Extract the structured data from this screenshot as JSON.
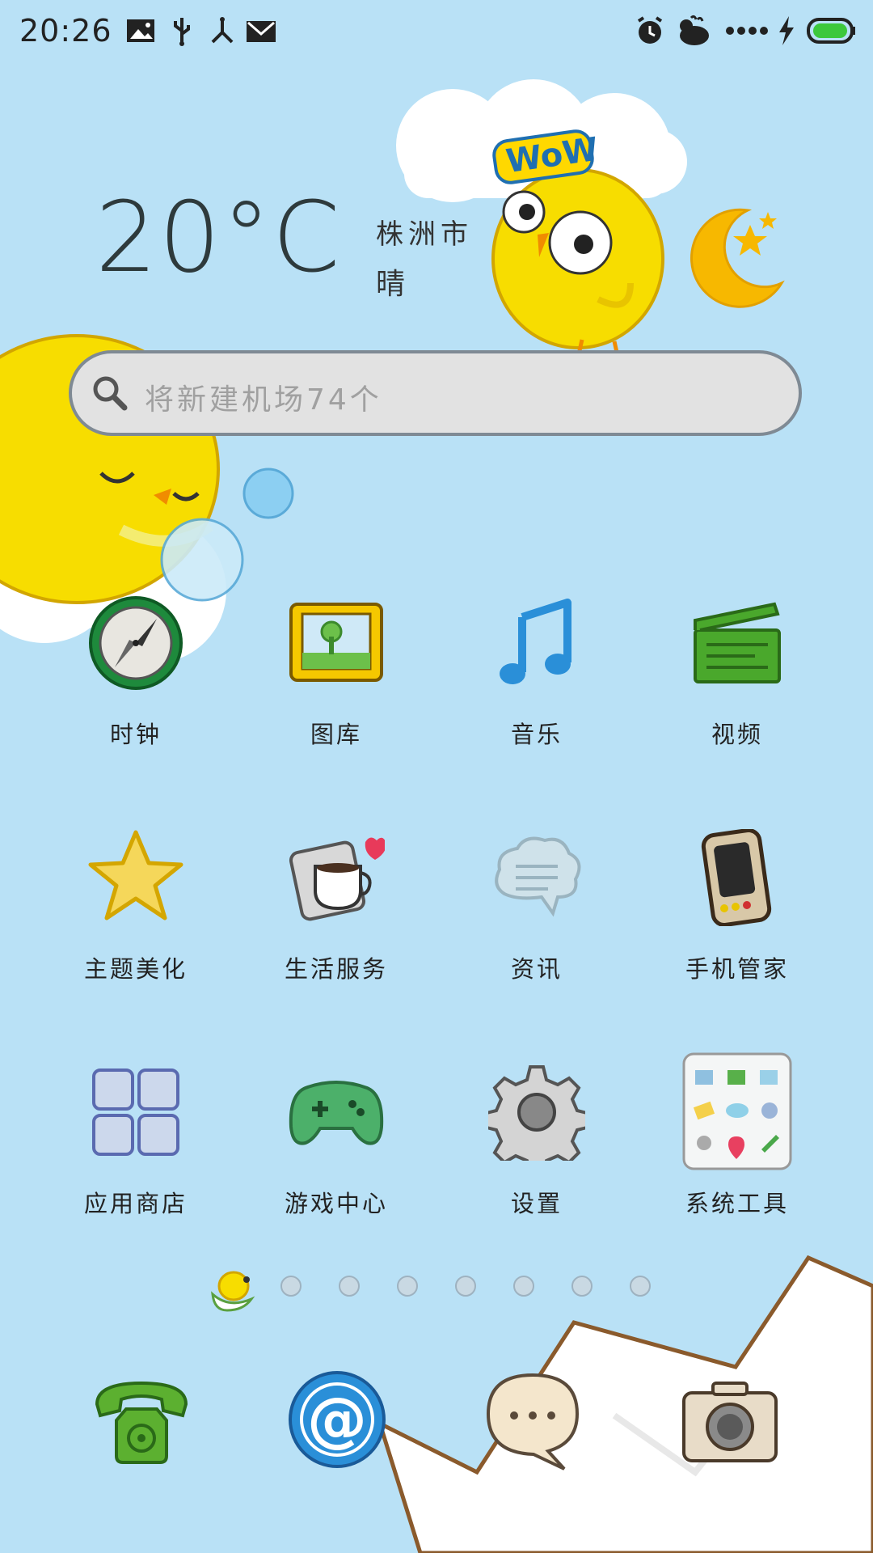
{
  "status_bar": {
    "time": "20:26",
    "left_icons": [
      "image-icon",
      "usb-icon",
      "share-icon",
      "mail-icon"
    ],
    "right_icons": [
      "alarm-icon",
      "bird-icon",
      "signal-dots-icon",
      "charging-icon",
      "battery-icon"
    ]
  },
  "weather": {
    "temperature": "20°C",
    "city": "株洲市",
    "condition": "晴"
  },
  "search": {
    "placeholder": "将新建机场74个"
  },
  "apps": [
    {
      "label": "时钟",
      "icon": "clock-icon"
    },
    {
      "label": "图库",
      "icon": "gallery-icon"
    },
    {
      "label": "音乐",
      "icon": "music-icon"
    },
    {
      "label": "视频",
      "icon": "video-icon"
    },
    {
      "label": "主题美化",
      "icon": "star-icon"
    },
    {
      "label": "生活服务",
      "icon": "coffee-icon"
    },
    {
      "label": "资讯",
      "icon": "news-cloud-icon"
    },
    {
      "label": "手机管家",
      "icon": "phone-manager-icon"
    },
    {
      "label": "应用商店",
      "icon": "app-store-icon"
    },
    {
      "label": "游戏中心",
      "icon": "gamepad-icon"
    },
    {
      "label": "设置",
      "icon": "gear-icon"
    },
    {
      "label": "系统工具",
      "icon": "tools-folder-icon"
    }
  ],
  "page_indicator": {
    "current": 1,
    "total": 8
  },
  "dock": [
    {
      "icon": "phone-icon"
    },
    {
      "icon": "email-at-icon"
    },
    {
      "icon": "message-icon"
    },
    {
      "icon": "camera-icon"
    }
  ],
  "colors": {
    "background": "#b9e1f6",
    "chick_yellow": "#f5d800",
    "search_bg": "#e2e2e2"
  }
}
